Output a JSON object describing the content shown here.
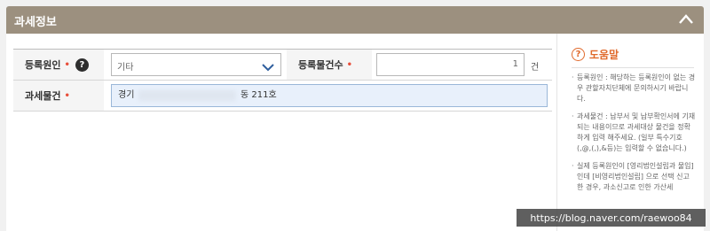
{
  "section": {
    "title": "과세정보"
  },
  "form": {
    "reg_reason": {
      "label": "등록원인",
      "required_mark": "•",
      "value": "기타"
    },
    "reg_count": {
      "label": "등록물건수",
      "required_mark": "•",
      "value": "1",
      "unit": "건"
    },
    "tax_item": {
      "label": "과세물건",
      "required_mark": "•",
      "prefix": "경기",
      "suffix": "동 211호"
    }
  },
  "help": {
    "title": "도움말",
    "tips": [
      "등록원인 : 해당하는 등록원인이 없는 경우 관할자치단체에 문의하시기 바랍니다.",
      "과세물건 : 납부서 및 납부확인서에 기재되는 내용이므로 과세대상 물건을 정확하게 입력 해주세요. (일부 특수기호 (,@,(,),&등)는 입력할 수 없습니다.)",
      "실제 등록원인이 [영리법인설립과 물입] 인데 [비영리법인설립] 으로 선택 신고한 경우, 과소신고로 인한 가산세"
    ]
  },
  "watermark": "https://blog.naver.com/raewoo84"
}
